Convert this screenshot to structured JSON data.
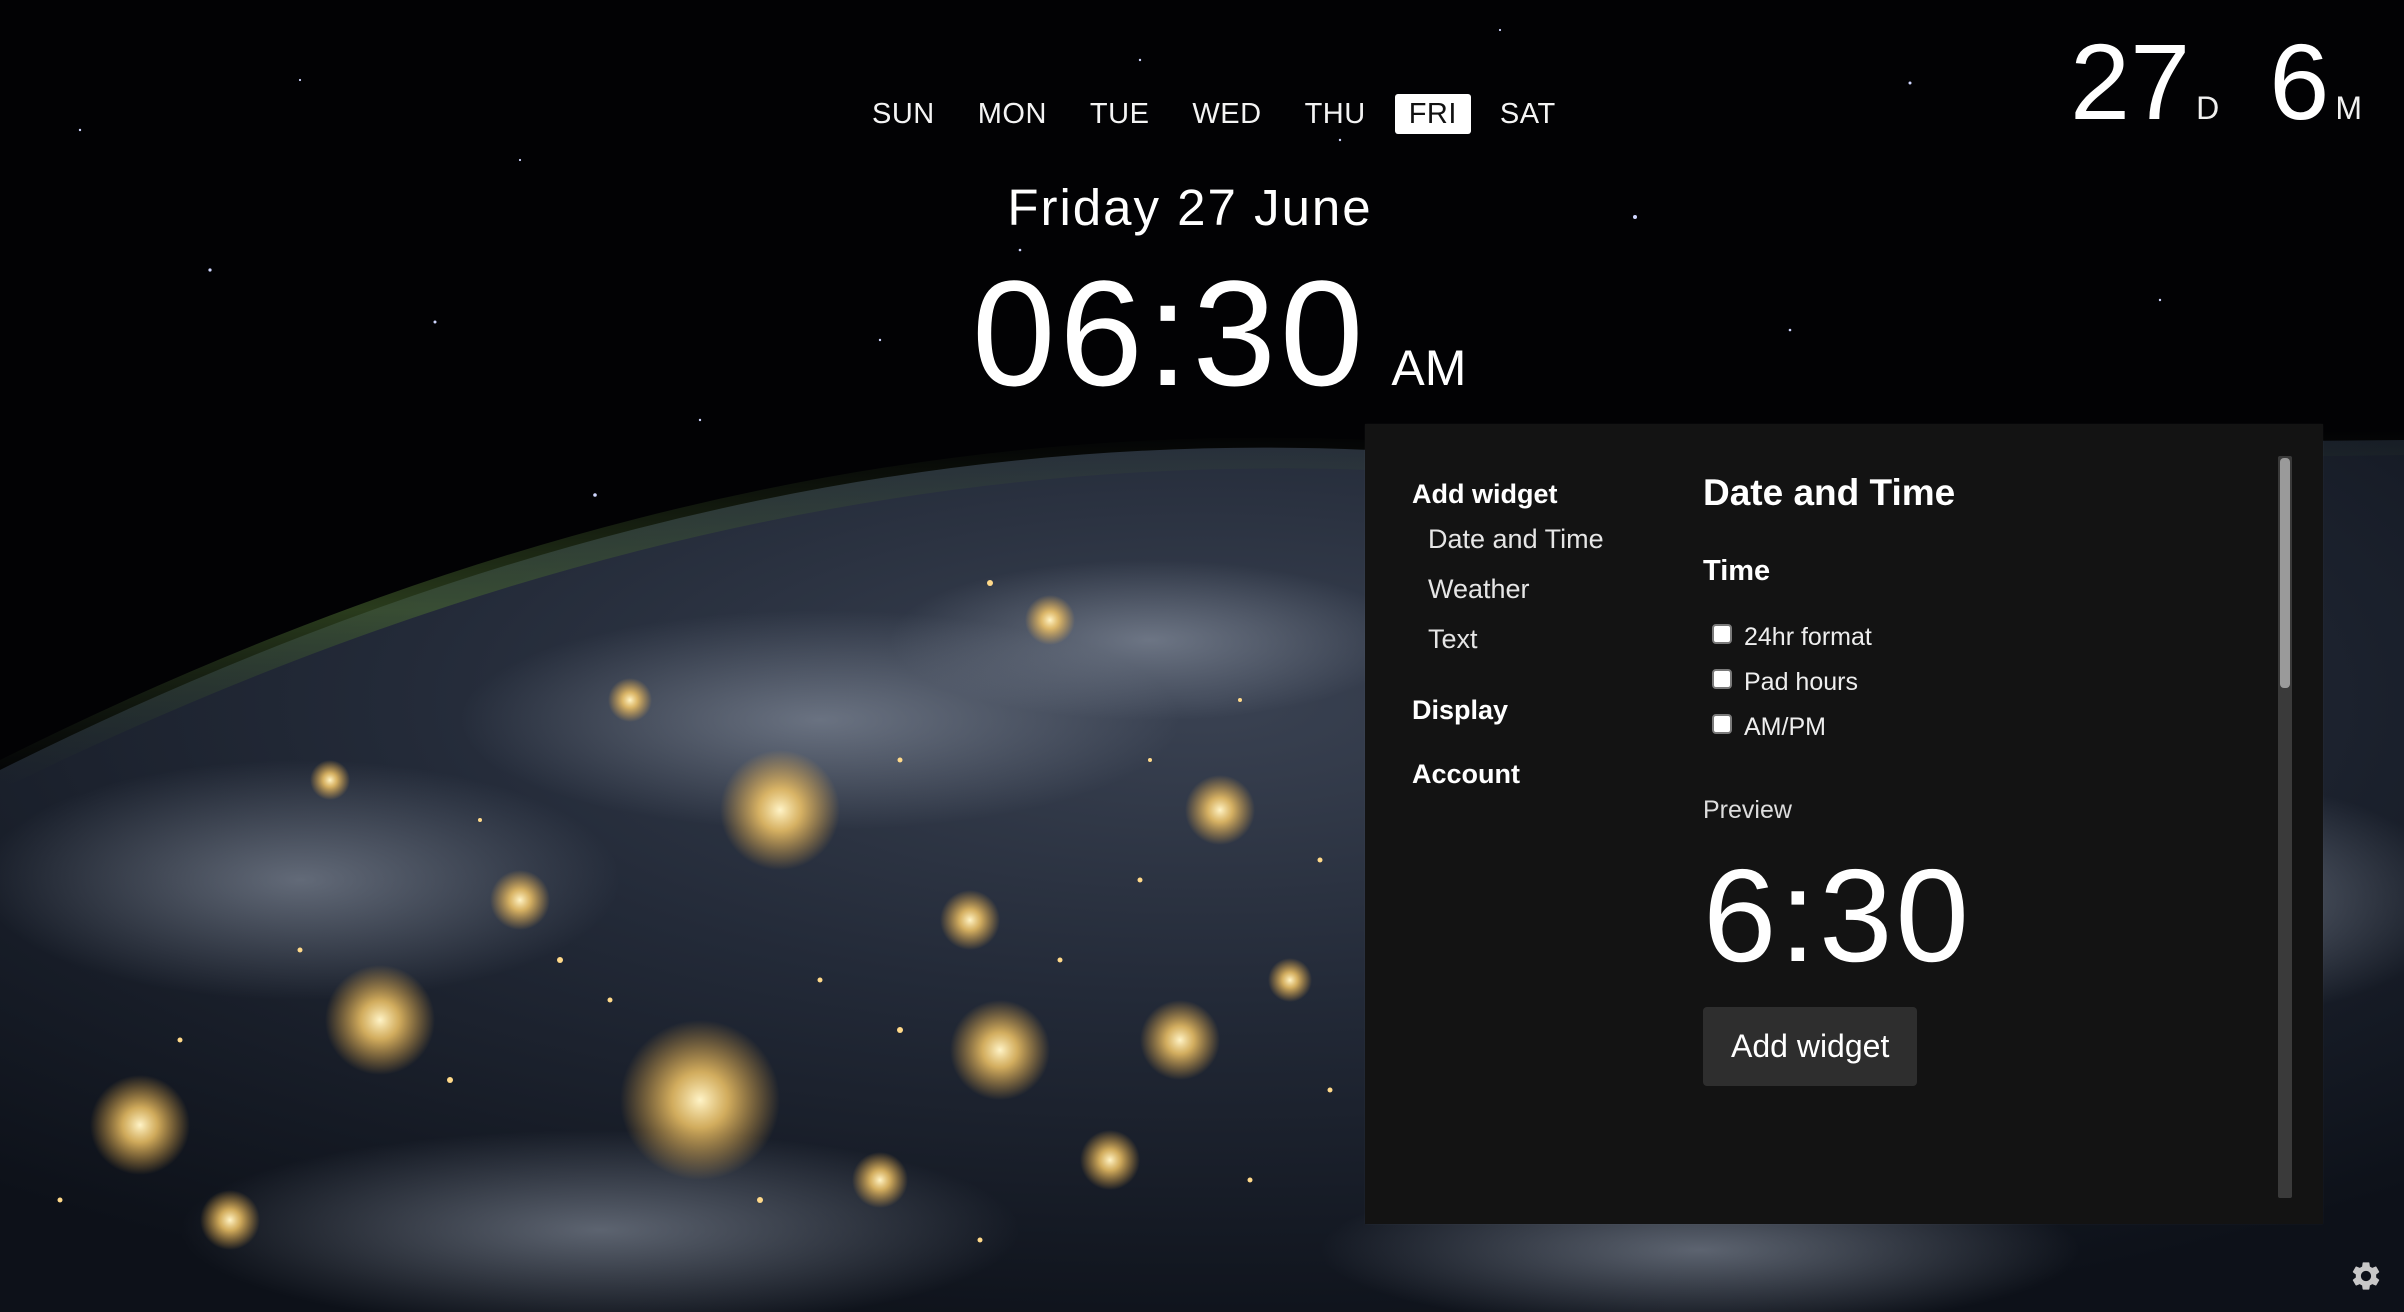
{
  "days": [
    {
      "label": "SUN",
      "active": false
    },
    {
      "label": "MON",
      "active": false
    },
    {
      "label": "TUE",
      "active": false
    },
    {
      "label": "WED",
      "active": false
    },
    {
      "label": "THU",
      "active": false
    },
    {
      "label": "FRI",
      "active": true
    },
    {
      "label": "SAT",
      "active": false
    }
  ],
  "countdown": {
    "days_value": "27",
    "days_unit": "D",
    "months_value": "6",
    "months_unit": "M"
  },
  "date_line": "Friday 27 June",
  "clock": {
    "time": "06:30",
    "ampm": "AM"
  },
  "panel": {
    "nav": {
      "add_widget": "Add widget",
      "items": [
        "Date and Time",
        "Weather",
        "Text"
      ],
      "display": "Display",
      "account": "Account"
    },
    "content": {
      "title": "Date and Time",
      "section": "Time",
      "options": [
        {
          "label": "24hr format",
          "checked": false
        },
        {
          "label": "Pad hours",
          "checked": false
        },
        {
          "label": "AM/PM",
          "checked": false
        }
      ],
      "preview_label": "Preview",
      "preview_time": "6:30",
      "add_button": "Add widget"
    }
  },
  "icons": {
    "settings": "gear-icon"
  },
  "colors": {
    "panel_bg": "#131313",
    "active_day_bg": "#ffffff",
    "button_bg": "#2e2e2e",
    "city_lights": "#ffd98a"
  }
}
